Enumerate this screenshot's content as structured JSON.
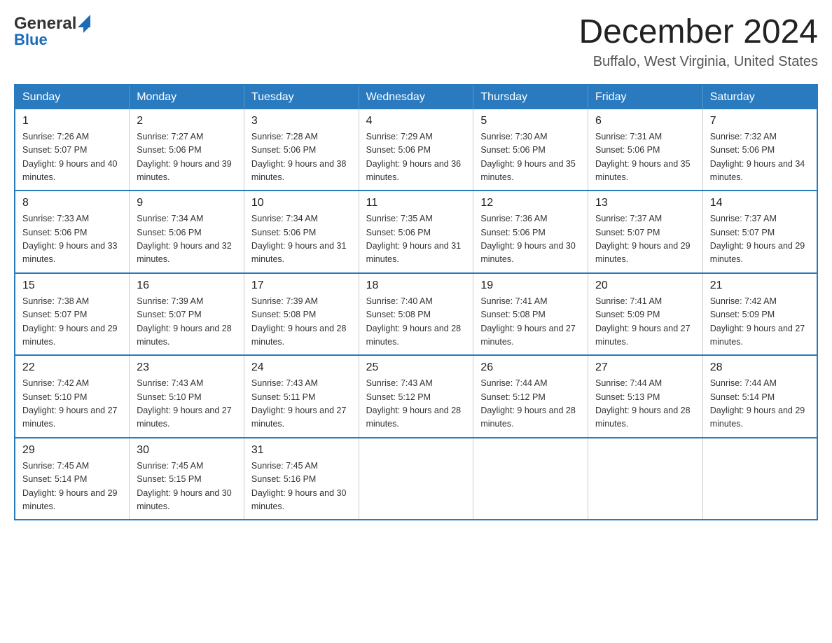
{
  "header": {
    "logo_general": "General",
    "logo_blue": "Blue",
    "month_title": "December 2024",
    "location": "Buffalo, West Virginia, United States"
  },
  "days_of_week": [
    "Sunday",
    "Monday",
    "Tuesday",
    "Wednesday",
    "Thursday",
    "Friday",
    "Saturday"
  ],
  "weeks": [
    [
      {
        "day": "1",
        "sunrise": "7:26 AM",
        "sunset": "5:07 PM",
        "daylight": "9 hours and 40 minutes."
      },
      {
        "day": "2",
        "sunrise": "7:27 AM",
        "sunset": "5:06 PM",
        "daylight": "9 hours and 39 minutes."
      },
      {
        "day": "3",
        "sunrise": "7:28 AM",
        "sunset": "5:06 PM",
        "daylight": "9 hours and 38 minutes."
      },
      {
        "day": "4",
        "sunrise": "7:29 AM",
        "sunset": "5:06 PM",
        "daylight": "9 hours and 36 minutes."
      },
      {
        "day": "5",
        "sunrise": "7:30 AM",
        "sunset": "5:06 PM",
        "daylight": "9 hours and 35 minutes."
      },
      {
        "day": "6",
        "sunrise": "7:31 AM",
        "sunset": "5:06 PM",
        "daylight": "9 hours and 35 minutes."
      },
      {
        "day": "7",
        "sunrise": "7:32 AM",
        "sunset": "5:06 PM",
        "daylight": "9 hours and 34 minutes."
      }
    ],
    [
      {
        "day": "8",
        "sunrise": "7:33 AM",
        "sunset": "5:06 PM",
        "daylight": "9 hours and 33 minutes."
      },
      {
        "day": "9",
        "sunrise": "7:34 AM",
        "sunset": "5:06 PM",
        "daylight": "9 hours and 32 minutes."
      },
      {
        "day": "10",
        "sunrise": "7:34 AM",
        "sunset": "5:06 PM",
        "daylight": "9 hours and 31 minutes."
      },
      {
        "day": "11",
        "sunrise": "7:35 AM",
        "sunset": "5:06 PM",
        "daylight": "9 hours and 31 minutes."
      },
      {
        "day": "12",
        "sunrise": "7:36 AM",
        "sunset": "5:06 PM",
        "daylight": "9 hours and 30 minutes."
      },
      {
        "day": "13",
        "sunrise": "7:37 AM",
        "sunset": "5:07 PM",
        "daylight": "9 hours and 29 minutes."
      },
      {
        "day": "14",
        "sunrise": "7:37 AM",
        "sunset": "5:07 PM",
        "daylight": "9 hours and 29 minutes."
      }
    ],
    [
      {
        "day": "15",
        "sunrise": "7:38 AM",
        "sunset": "5:07 PM",
        "daylight": "9 hours and 29 minutes."
      },
      {
        "day": "16",
        "sunrise": "7:39 AM",
        "sunset": "5:07 PM",
        "daylight": "9 hours and 28 minutes."
      },
      {
        "day": "17",
        "sunrise": "7:39 AM",
        "sunset": "5:08 PM",
        "daylight": "9 hours and 28 minutes."
      },
      {
        "day": "18",
        "sunrise": "7:40 AM",
        "sunset": "5:08 PM",
        "daylight": "9 hours and 28 minutes."
      },
      {
        "day": "19",
        "sunrise": "7:41 AM",
        "sunset": "5:08 PM",
        "daylight": "9 hours and 27 minutes."
      },
      {
        "day": "20",
        "sunrise": "7:41 AM",
        "sunset": "5:09 PM",
        "daylight": "9 hours and 27 minutes."
      },
      {
        "day": "21",
        "sunrise": "7:42 AM",
        "sunset": "5:09 PM",
        "daylight": "9 hours and 27 minutes."
      }
    ],
    [
      {
        "day": "22",
        "sunrise": "7:42 AM",
        "sunset": "5:10 PM",
        "daylight": "9 hours and 27 minutes."
      },
      {
        "day": "23",
        "sunrise": "7:43 AM",
        "sunset": "5:10 PM",
        "daylight": "9 hours and 27 minutes."
      },
      {
        "day": "24",
        "sunrise": "7:43 AM",
        "sunset": "5:11 PM",
        "daylight": "9 hours and 27 minutes."
      },
      {
        "day": "25",
        "sunrise": "7:43 AM",
        "sunset": "5:12 PM",
        "daylight": "9 hours and 28 minutes."
      },
      {
        "day": "26",
        "sunrise": "7:44 AM",
        "sunset": "5:12 PM",
        "daylight": "9 hours and 28 minutes."
      },
      {
        "day": "27",
        "sunrise": "7:44 AM",
        "sunset": "5:13 PM",
        "daylight": "9 hours and 28 minutes."
      },
      {
        "day": "28",
        "sunrise": "7:44 AM",
        "sunset": "5:14 PM",
        "daylight": "9 hours and 29 minutes."
      }
    ],
    [
      {
        "day": "29",
        "sunrise": "7:45 AM",
        "sunset": "5:14 PM",
        "daylight": "9 hours and 29 minutes."
      },
      {
        "day": "30",
        "sunrise": "7:45 AM",
        "sunset": "5:15 PM",
        "daylight": "9 hours and 30 minutes."
      },
      {
        "day": "31",
        "sunrise": "7:45 AM",
        "sunset": "5:16 PM",
        "daylight": "9 hours and 30 minutes."
      },
      null,
      null,
      null,
      null
    ]
  ],
  "colors": {
    "header_bg": "#2a7abf",
    "border": "#2a7abf",
    "logo_blue": "#1a6bba"
  }
}
